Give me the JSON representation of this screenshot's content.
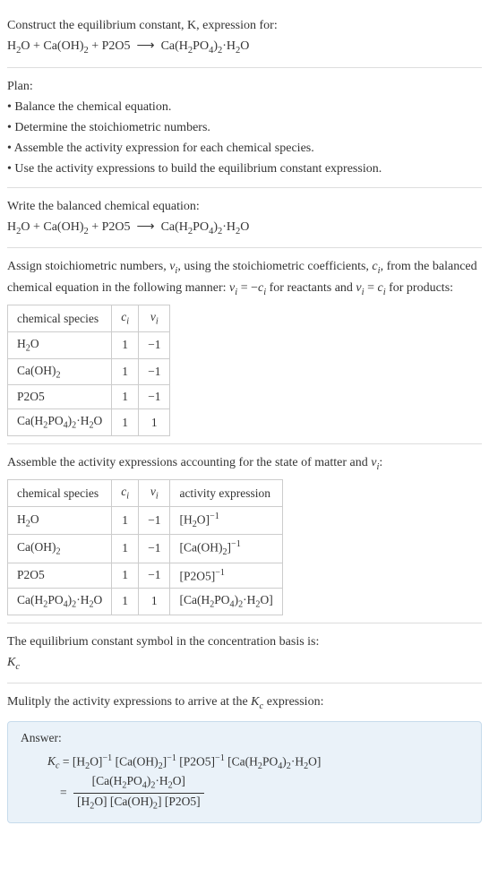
{
  "intro": {
    "l1": "Construct the equilibrium constant, K, expression for:",
    "l2_html": "H<sub>2</sub>O + Ca(OH)<sub>2</sub> + P2O5 &nbsp;⟶&nbsp; Ca(H<sub>2</sub>PO<sub>4</sub>)<sub>2</sub>·H<sub>2</sub>O"
  },
  "plan": {
    "title": "Plan:",
    "b1": "• Balance the chemical equation.",
    "b2": "• Determine the stoichiometric numbers.",
    "b3": "• Assemble the activity expression for each chemical species.",
    "b4": "• Use the activity expressions to build the equilibrium constant expression."
  },
  "balanced": {
    "l1": "Write the balanced chemical equation:",
    "l2_html": "H<sub>2</sub>O + Ca(OH)<sub>2</sub> + P2O5 &nbsp;⟶&nbsp; Ca(H<sub>2</sub>PO<sub>4</sub>)<sub>2</sub>·H<sub>2</sub>O"
  },
  "stoich": {
    "p_html": "Assign stoichiometric numbers, <i>ν<sub>i</sub></i>, using the stoichiometric coefficients, <i>c<sub>i</sub></i>, from the balanced chemical equation in the following manner: <i>ν<sub>i</sub></i> = −<i>c<sub>i</sub></i> for reactants and <i>ν<sub>i</sub></i> = <i>c<sub>i</sub></i> for products:",
    "h1": "chemical species",
    "h2_html": "<i>c<sub>i</sub></i>",
    "h3_html": "<i>ν<sub>i</sub></i>",
    "rows": [
      {
        "sp_html": "H<sub>2</sub>O",
        "c": "1",
        "v": "−1"
      },
      {
        "sp_html": "Ca(OH)<sub>2</sub>",
        "c": "1",
        "v": "−1"
      },
      {
        "sp_html": "P2O5",
        "c": "1",
        "v": "−1"
      },
      {
        "sp_html": "Ca(H<sub>2</sub>PO<sub>4</sub>)<sub>2</sub>·H<sub>2</sub>O",
        "c": "1",
        "v": "1"
      }
    ]
  },
  "activity": {
    "p_html": "Assemble the activity expressions accounting for the state of matter and <i>ν<sub>i</sub></i>:",
    "h1": "chemical species",
    "h2_html": "<i>c<sub>i</sub></i>",
    "h3_html": "<i>ν<sub>i</sub></i>",
    "h4": "activity expression",
    "rows": [
      {
        "sp_html": "H<sub>2</sub>O",
        "c": "1",
        "v": "−1",
        "a_html": "[H<sub>2</sub>O]<sup>−1</sup>"
      },
      {
        "sp_html": "Ca(OH)<sub>2</sub>",
        "c": "1",
        "v": "−1",
        "a_html": "[Ca(OH)<sub>2</sub>]<sup>−1</sup>"
      },
      {
        "sp_html": "P2O5",
        "c": "1",
        "v": "−1",
        "a_html": "[P2O5]<sup>−1</sup>"
      },
      {
        "sp_html": "Ca(H<sub>2</sub>PO<sub>4</sub>)<sub>2</sub>·H<sub>2</sub>O",
        "c": "1",
        "v": "1",
        "a_html": "[Ca(H<sub>2</sub>PO<sub>4</sub>)<sub>2</sub>·H<sub>2</sub>O]"
      }
    ]
  },
  "kcstatement": {
    "l1": "The equilibrium constant symbol in the concentration basis is:",
    "l2_html": "<i>K<sub>c</sub></i>"
  },
  "multiply": {
    "p_html": "Mulitply the activity expressions to arrive at the <i>K<sub>c</sub></i> expression:"
  },
  "answer": {
    "label": "Answer:",
    "line1_html": "<i>K<sub>c</sub></i> = [H<sub>2</sub>O]<sup>−1</sup> [Ca(OH)<sub>2</sub>]<sup>−1</sup> [P2O5]<sup>−1</sup> [Ca(H<sub>2</sub>PO<sub>4</sub>)<sub>2</sub>·H<sub>2</sub>O]",
    "frac_num_html": "[Ca(H<sub>2</sub>PO<sub>4</sub>)<sub>2</sub>·H<sub>2</sub>O]",
    "frac_den_html": "[H<sub>2</sub>O] [Ca(OH)<sub>2</sub>] [P2O5]"
  }
}
